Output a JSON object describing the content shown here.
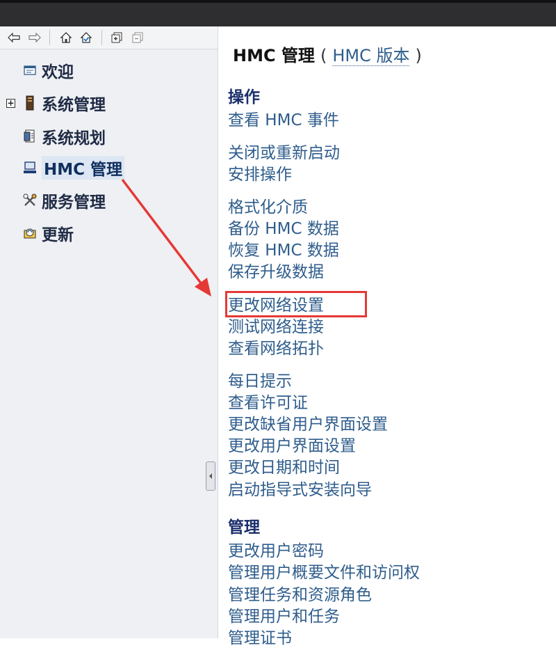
{
  "toolbar": {
    "icons": [
      "back-arrow-icon",
      "forward-arrow-icon",
      "home-icon",
      "home-check-icon",
      "expand-all-icon",
      "collapse-all-icon"
    ]
  },
  "nav": {
    "items": [
      {
        "label": "欢迎",
        "icon": "welcome-icon"
      },
      {
        "label": "系统管理",
        "icon": "server-icon",
        "expandable": true
      },
      {
        "label": "系统规划",
        "icon": "planning-icon"
      },
      {
        "label": "HMC 管理",
        "icon": "hmc-icon",
        "selected": true
      },
      {
        "label": "服务管理",
        "icon": "service-tools-icon"
      },
      {
        "label": "更新",
        "icon": "update-icon"
      }
    ]
  },
  "main": {
    "title_bold": "HMC 管理",
    "paren_open": "(",
    "version_link": "HMC 版本",
    "paren_close": ")",
    "sections": [
      {
        "heading": "操作",
        "groups": [
          [
            "查看 HMC 事件"
          ],
          [
            "关闭或重新启动",
            "安排操作"
          ],
          [
            "格式化介质",
            "备份 HMC 数据",
            "恢复 HMC 数据",
            "保存升级数据"
          ],
          [
            "更改网络设置",
            "测试网络连接",
            "查看网络拓扑"
          ],
          [
            "每日提示",
            "查看许可证",
            "更改缺省用户界面设置",
            "更改用户界面设置",
            "更改日期和时间",
            "启动指导式安装向导"
          ]
        ]
      },
      {
        "heading": "管理",
        "groups": [
          [
            "更改用户密码",
            "管理用户概要文件和访问权",
            "管理任务和资源角色",
            "管理用户和任务",
            "管理证书"
          ]
        ]
      }
    ]
  },
  "annotation": {
    "highlighted_item": "更改网络设置",
    "color": "#e53935"
  },
  "colors": {
    "link": "#2f5d8c",
    "heading": "#1b2f6b",
    "topbar": "#2e2e30"
  }
}
